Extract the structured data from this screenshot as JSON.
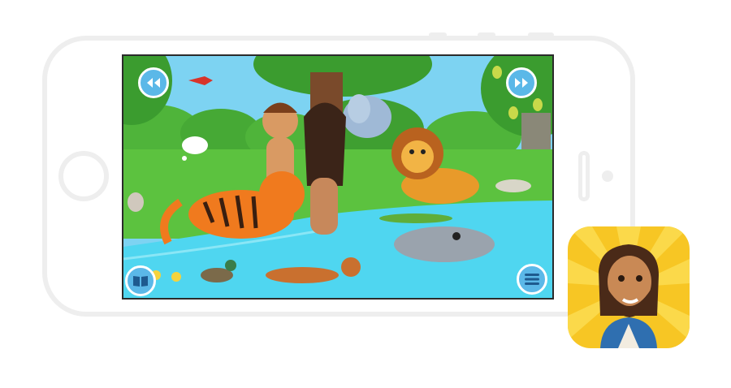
{
  "app": {
    "title": "",
    "icon_name": "jesus-app-icon"
  },
  "controls": {
    "back_icon": "rewind-icon",
    "forward_icon": "fast-forward-icon",
    "library_icon": "book-icon",
    "menu_icon": "menu-icon"
  },
  "colors": {
    "sky": "#7dd3f2",
    "grass": "#5cc23f",
    "water": "#4fd6f0",
    "button": "#5bb8e8",
    "icon_bg": "#f7c624"
  }
}
